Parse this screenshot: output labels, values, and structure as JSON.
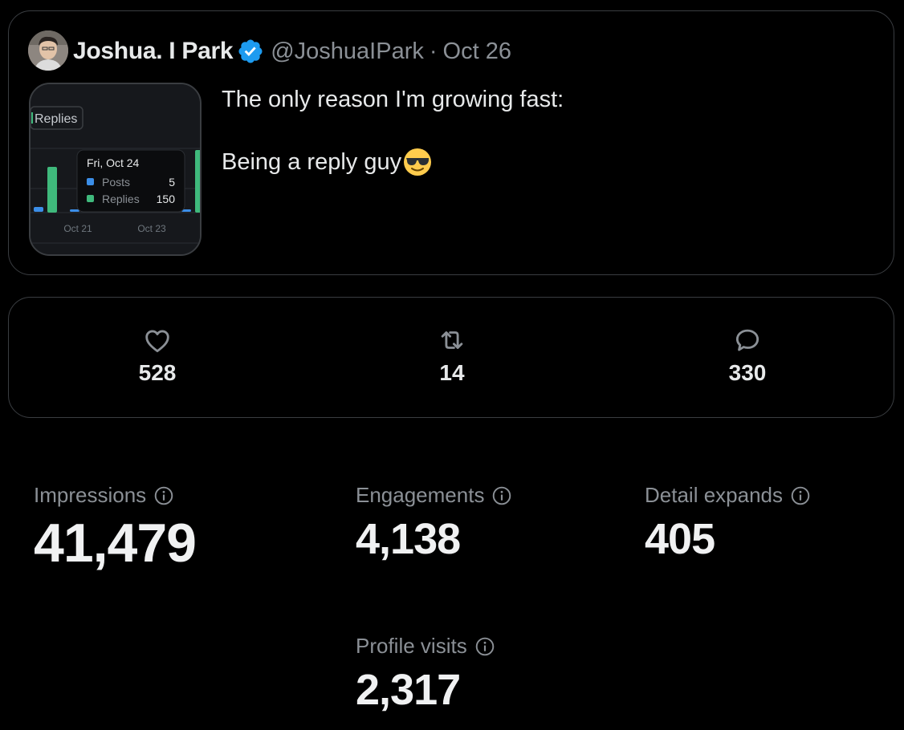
{
  "tweet": {
    "author_name": "Joshua. I Park",
    "handle": "@JoshuaIPark",
    "separator": "·",
    "date": "Oct 26",
    "text_line1": "The only reason I'm growing fast:",
    "text_line2": "Being a reply guy",
    "emoji": "smiling-face-with-sunglasses",
    "thumbnail": {
      "filter_label": "Replies",
      "tooltip_date": "Fri, Oct 24",
      "tooltip_rows": [
        {
          "label": "Posts",
          "value": "5",
          "color": "#3b8ee8"
        },
        {
          "label": "Replies",
          "value": "150",
          "color": "#3fb97c"
        }
      ],
      "x_ticks": [
        "Oct 21",
        "Oct 23"
      ]
    }
  },
  "engagement": {
    "likes": "528",
    "reposts": "14",
    "replies": "330"
  },
  "metrics": {
    "impressions_label": "Impressions",
    "impressions_value": "41,479",
    "engagements_label": "Engagements",
    "engagements_value": "4,138",
    "detail_expands_label": "Detail expands",
    "detail_expands_value": "405",
    "profile_visits_label": "Profile visits",
    "profile_visits_value": "2,317"
  },
  "colors": {
    "background": "#000000",
    "border": "#3a3d41",
    "text_primary": "#e7e9ea",
    "text_secondary": "#8b9096",
    "verified_blue": "#1d9bf0",
    "posts_blue": "#3b8ee8",
    "replies_green": "#3fb97c"
  }
}
